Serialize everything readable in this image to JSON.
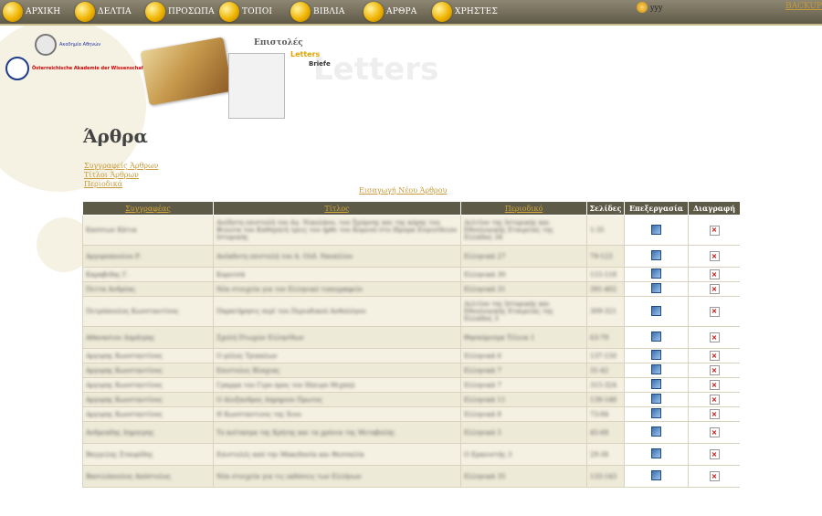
{
  "nav": {
    "items": [
      {
        "label": "ΑΡΧΙΚΗ",
        "icon": "back-arrow-icon"
      },
      {
        "label": "ΔΕΛΤΙΑ",
        "icon": "card-icon"
      },
      {
        "label": "ΠΡΟΣΩΠΑ",
        "icon": "person-icon"
      },
      {
        "label": "ΤΟΠΟΙ",
        "icon": "globe-icon"
      },
      {
        "label": "ΒΙΒΛΙΑ",
        "icon": "book-icon"
      },
      {
        "label": "ΑΡΘΡΑ",
        "icon": "open-book-icon"
      },
      {
        "label": "ΧΡΗΣΤΕΣ",
        "icon": "users-icon"
      }
    ],
    "username": "yyy",
    "backup": "BACKUP"
  },
  "logos": {
    "academy_athens": "Ακαδημία Αθηνών",
    "oeaw": "Österreichische Akademie der Wissenschaften"
  },
  "banner": {
    "greek": "Επιστολές",
    "english": "Letters",
    "german": "Briefe",
    "big_greek": "Επιστολές",
    "big_english": "Letters"
  },
  "page": {
    "title": "Άρθρα",
    "links": [
      "Συγγραφείς Άρθρων",
      "Τίτλοι Άρθρων",
      "Περιοδικά"
    ],
    "new_article": "Εισαγωγή Νέου Άρθρου"
  },
  "table": {
    "headers": [
      "Συγγραφέας",
      "Τίτλος",
      "Περιοδικό",
      "Σελίδες",
      "Επεξεργασία",
      "Διαγραφή"
    ],
    "rows": [
      {
        "author": "Κασσιων Κάτια",
        "title": "Ανέδοτη επιστολή του Αγ. Νικολάου, του Σμύρνης και της κόρης του Φιλώτα του Καθηγητή τρεις του ήρθε του Κομνού στο Ιδρυμα Ευγενίδειου Ιστορικής",
        "journal": "Δελτίον της Ιστορικής και Εθνολογικής Εταιρείας της Ελλάδος 34",
        "pages": "1-35"
      },
      {
        "author": "Αργυροπουλου Ρ.",
        "title": "Ανέκδοτη επιστολή του Α. Ολδ. Ναυπλίου",
        "journal": "Ελληνικά 27",
        "pages": "79-123"
      },
      {
        "author": "Καραβιδης Γ.",
        "title": "Κορυτσά",
        "journal": "Ελληνικά 30",
        "pages": "115-118"
      },
      {
        "author": "Πεττα Ανδρέας",
        "title": "Νέα στοιχεία για τον Ελληνικό τυπογραφείο",
        "journal": "Ελληνικά 31",
        "pages": "391-402"
      },
      {
        "author": "Πετρόπουλος Κωνσταντίνος",
        "title": "Παρατήρησις περί του Περιοδικού Ανθολόγου",
        "journal": "Δελτίον της Ιστορικής και Εθνολογικής Εταιρείας της Ελλάδος 3",
        "pages": "309-321"
      },
      {
        "author": "Αθανασιου Δημήτρης",
        "title": "Σχολή Πτωχών Ελληνίδων",
        "journal": "Θησαύρισμα Τέλεια 1",
        "pages": "63-79"
      },
      {
        "author": "Αργυρης Κωνσταντίνος",
        "title": "Ο μύλος Τρικαλων",
        "journal": "Ελληνικά 6",
        "pages": "137-150"
      },
      {
        "author": "Αργυρης Κωνσταντίνος",
        "title": "Επιστολες Βλαχιας",
        "journal": "Ελληνικά 7",
        "pages": "31-42"
      },
      {
        "author": "Αργυρης Κωνσταντίνος",
        "title": "Γραμμα του Γερο προς τον Ηπειρο Μιχαηλ",
        "journal": "Ελληνικά 7",
        "pages": "315-324"
      },
      {
        "author": "Αργυρης Κωνσταντίνος",
        "title": "Ο Αλεξανδρος Δημηριου Πρωτος",
        "journal": "Ελληνικά 11",
        "pages": "139-148"
      },
      {
        "author": "Αργυρης Κωνσταντίνος",
        "title": "Η Κωνσταντινος της Χιου",
        "journal": "Ελληνικά 8",
        "pages": "73-84"
      },
      {
        "author": "Ανδρεαδης Δημητρης",
        "title": "Το κοίτασμα της Κρήτης και τα χρόνια της Μεταβολής",
        "journal": "Ελληνικά 5",
        "pages": "45-68"
      },
      {
        "author": "Βαγγελης Σταυρίδης",
        "title": "Επιστολές από την Μακεδονία και Θεσσαλία",
        "journal": "Ο Ερανιστής 3",
        "pages": "29-38"
      },
      {
        "author": "Βασιλόπουλος Απόστολος",
        "title": "Νέα στοιχεία για τις εκδόσεις των Ελλήνων",
        "journal": "Ελληνικά 35",
        "pages": "133-143"
      }
    ]
  },
  "colors": {
    "nav_bg": "#6e6955",
    "link": "#c49a3a",
    "header_bg": "#5e5a48",
    "row_bg": "#f5f1e2"
  }
}
